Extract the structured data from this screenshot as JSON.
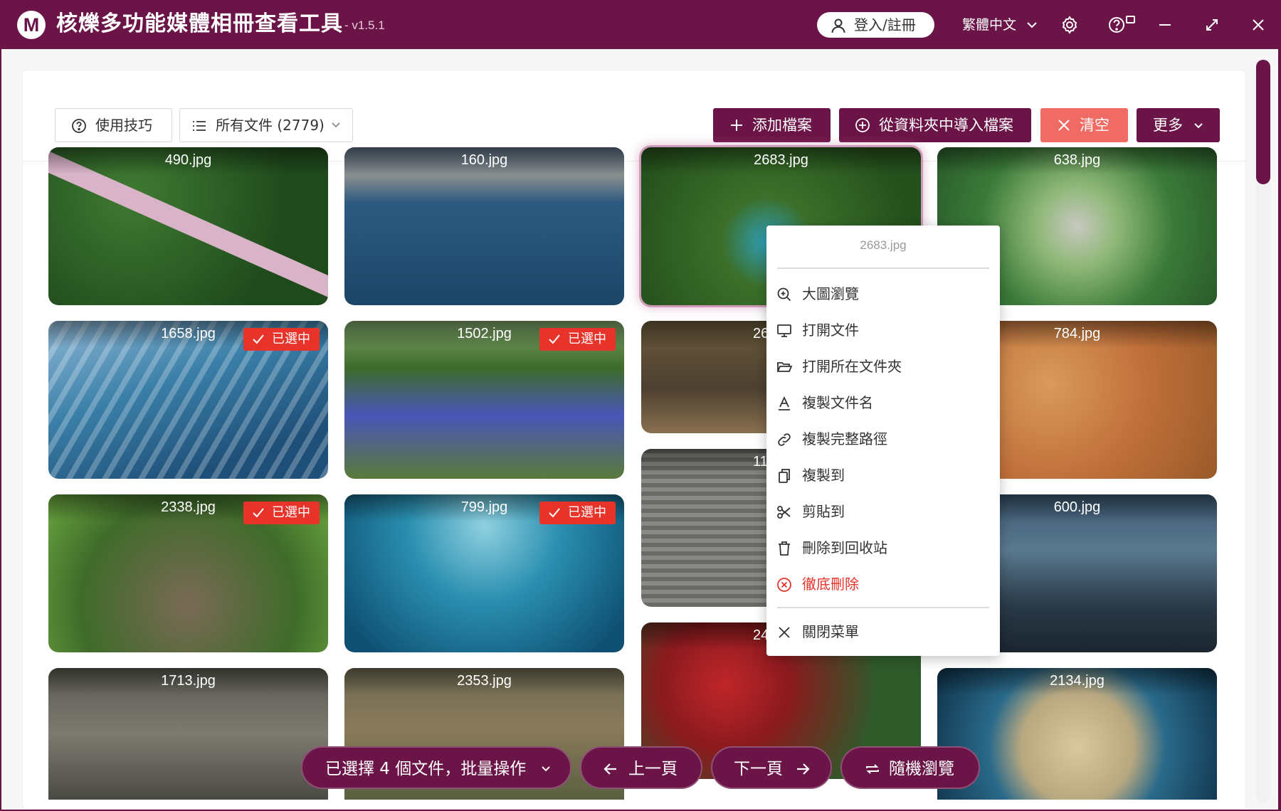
{
  "app": {
    "logo_letter": "M",
    "title": "核爍多功能媒體相冊查看工具",
    "version": "- v1.5.1",
    "login_label": "登入/註冊",
    "language": "繁體中文",
    "brand_color": "#6b1447",
    "danger_color": "#e8332a"
  },
  "toolbar": {
    "tips_label": "使用技巧",
    "filter_label": "所有文件 (2779)",
    "add_label": "添加檔案",
    "import_label": "從資料夾中導入檔案",
    "clear_label": "清空",
    "more_label": "更多"
  },
  "selected_badge": "已選中",
  "tiles": [
    {
      "name": "490.jpg",
      "selected": false
    },
    {
      "name": "160.jpg",
      "selected": false
    },
    {
      "name": "2683.jpg",
      "selected": false
    },
    {
      "name": "638.jpg",
      "selected": false
    },
    {
      "name": "1658.jpg",
      "selected": true
    },
    {
      "name": "1502.jpg",
      "selected": true
    },
    {
      "name": "26",
      "selected": false
    },
    {
      "name": "784.jpg",
      "selected": false
    },
    {
      "name": "11",
      "selected": false
    },
    {
      "name": "2338.jpg",
      "selected": true
    },
    {
      "name": "799.jpg",
      "selected": true
    },
    {
      "name": "600.jpg",
      "selected": false
    },
    {
      "name": "24",
      "selected": false
    },
    {
      "name": "1713.jpg",
      "selected": false
    },
    {
      "name": "2353.jpg",
      "selected": false
    },
    {
      "name": "2134.jpg",
      "selected": false
    }
  ],
  "context_menu": {
    "title": "2683.jpg",
    "items": [
      {
        "label": "大圖瀏覽",
        "icon": "zoom-in-icon"
      },
      {
        "label": "打開文件",
        "icon": "monitor-icon"
      },
      {
        "label": "打開所在文件夾",
        "icon": "folder-open-icon"
      },
      {
        "label": "複製文件名",
        "icon": "text-a-icon"
      },
      {
        "label": "複製完整路徑",
        "icon": "link-icon"
      },
      {
        "label": "複製到",
        "icon": "copy-icon"
      },
      {
        "label": "剪貼到",
        "icon": "scissors-icon"
      },
      {
        "label": "刪除到回收站",
        "icon": "trash-icon"
      },
      {
        "label": "徹底刪除",
        "icon": "close-circle-icon"
      }
    ],
    "close_label": "關閉菜單"
  },
  "bottom_bar": {
    "batch_label": "已選擇 4 個文件，批量操作",
    "prev_label": "上一頁",
    "next_label": "下一頁",
    "random_label": "隨機瀏覽"
  }
}
